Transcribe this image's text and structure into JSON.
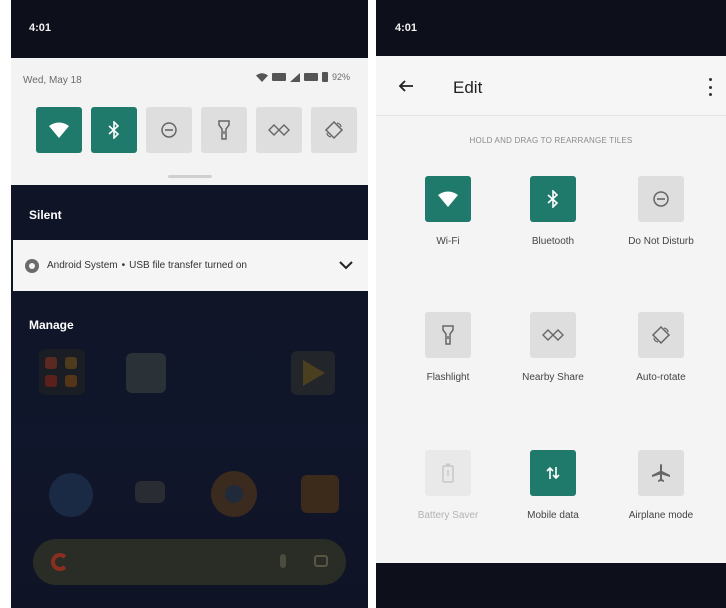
{
  "left_screen": {
    "status_time": "4:01",
    "quick_settings": {
      "date": "Wed, May 18",
      "battery_percent": "92%",
      "tiles": [
        {
          "name": "wifi",
          "icon": "wifi-icon",
          "active": true
        },
        {
          "name": "bluetooth",
          "icon": "bluetooth-icon",
          "active": true
        },
        {
          "name": "do-not-disturb",
          "icon": "do-not-disturb-icon",
          "active": false
        },
        {
          "name": "flashlight",
          "icon": "flashlight-icon",
          "active": false
        },
        {
          "name": "nearby-share",
          "icon": "nearby-share-icon",
          "active": false
        },
        {
          "name": "auto-rotate",
          "icon": "auto-rotate-icon",
          "active": false
        }
      ]
    },
    "silent_label": "Silent",
    "notification": {
      "app": "Android System",
      "separator": "•",
      "message": "USB file transfer turned on"
    },
    "manage_label": "Manage"
  },
  "right_screen": {
    "status_time": "4:01",
    "header_title": "Edit",
    "hint": "HOLD AND DRAG TO REARRANGE TILES",
    "tiles": [
      {
        "label": "Wi-Fi",
        "icon": "wifi-icon",
        "state": "on"
      },
      {
        "label": "Bluetooth",
        "icon": "bluetooth-icon",
        "state": "on"
      },
      {
        "label": "Do Not Disturb",
        "icon": "do-not-disturb-icon",
        "state": "off"
      },
      {
        "label": "Flashlight",
        "icon": "flashlight-icon",
        "state": "off"
      },
      {
        "label": "Nearby Share",
        "icon": "nearby-share-icon",
        "state": "off"
      },
      {
        "label": "Auto-rotate",
        "icon": "auto-rotate-icon",
        "state": "off"
      },
      {
        "label": "Battery Saver",
        "icon": "battery-saver-icon",
        "state": "disabled"
      },
      {
        "label": "Mobile data",
        "icon": "mobile-data-icon",
        "state": "on"
      },
      {
        "label": "Airplane mode",
        "icon": "airplane-icon",
        "state": "off"
      }
    ]
  },
  "colors": {
    "accent": "#1f7a6c",
    "tile_off": "#dedede",
    "panel": "#f4f4f4",
    "background": "#0d0f1a"
  }
}
